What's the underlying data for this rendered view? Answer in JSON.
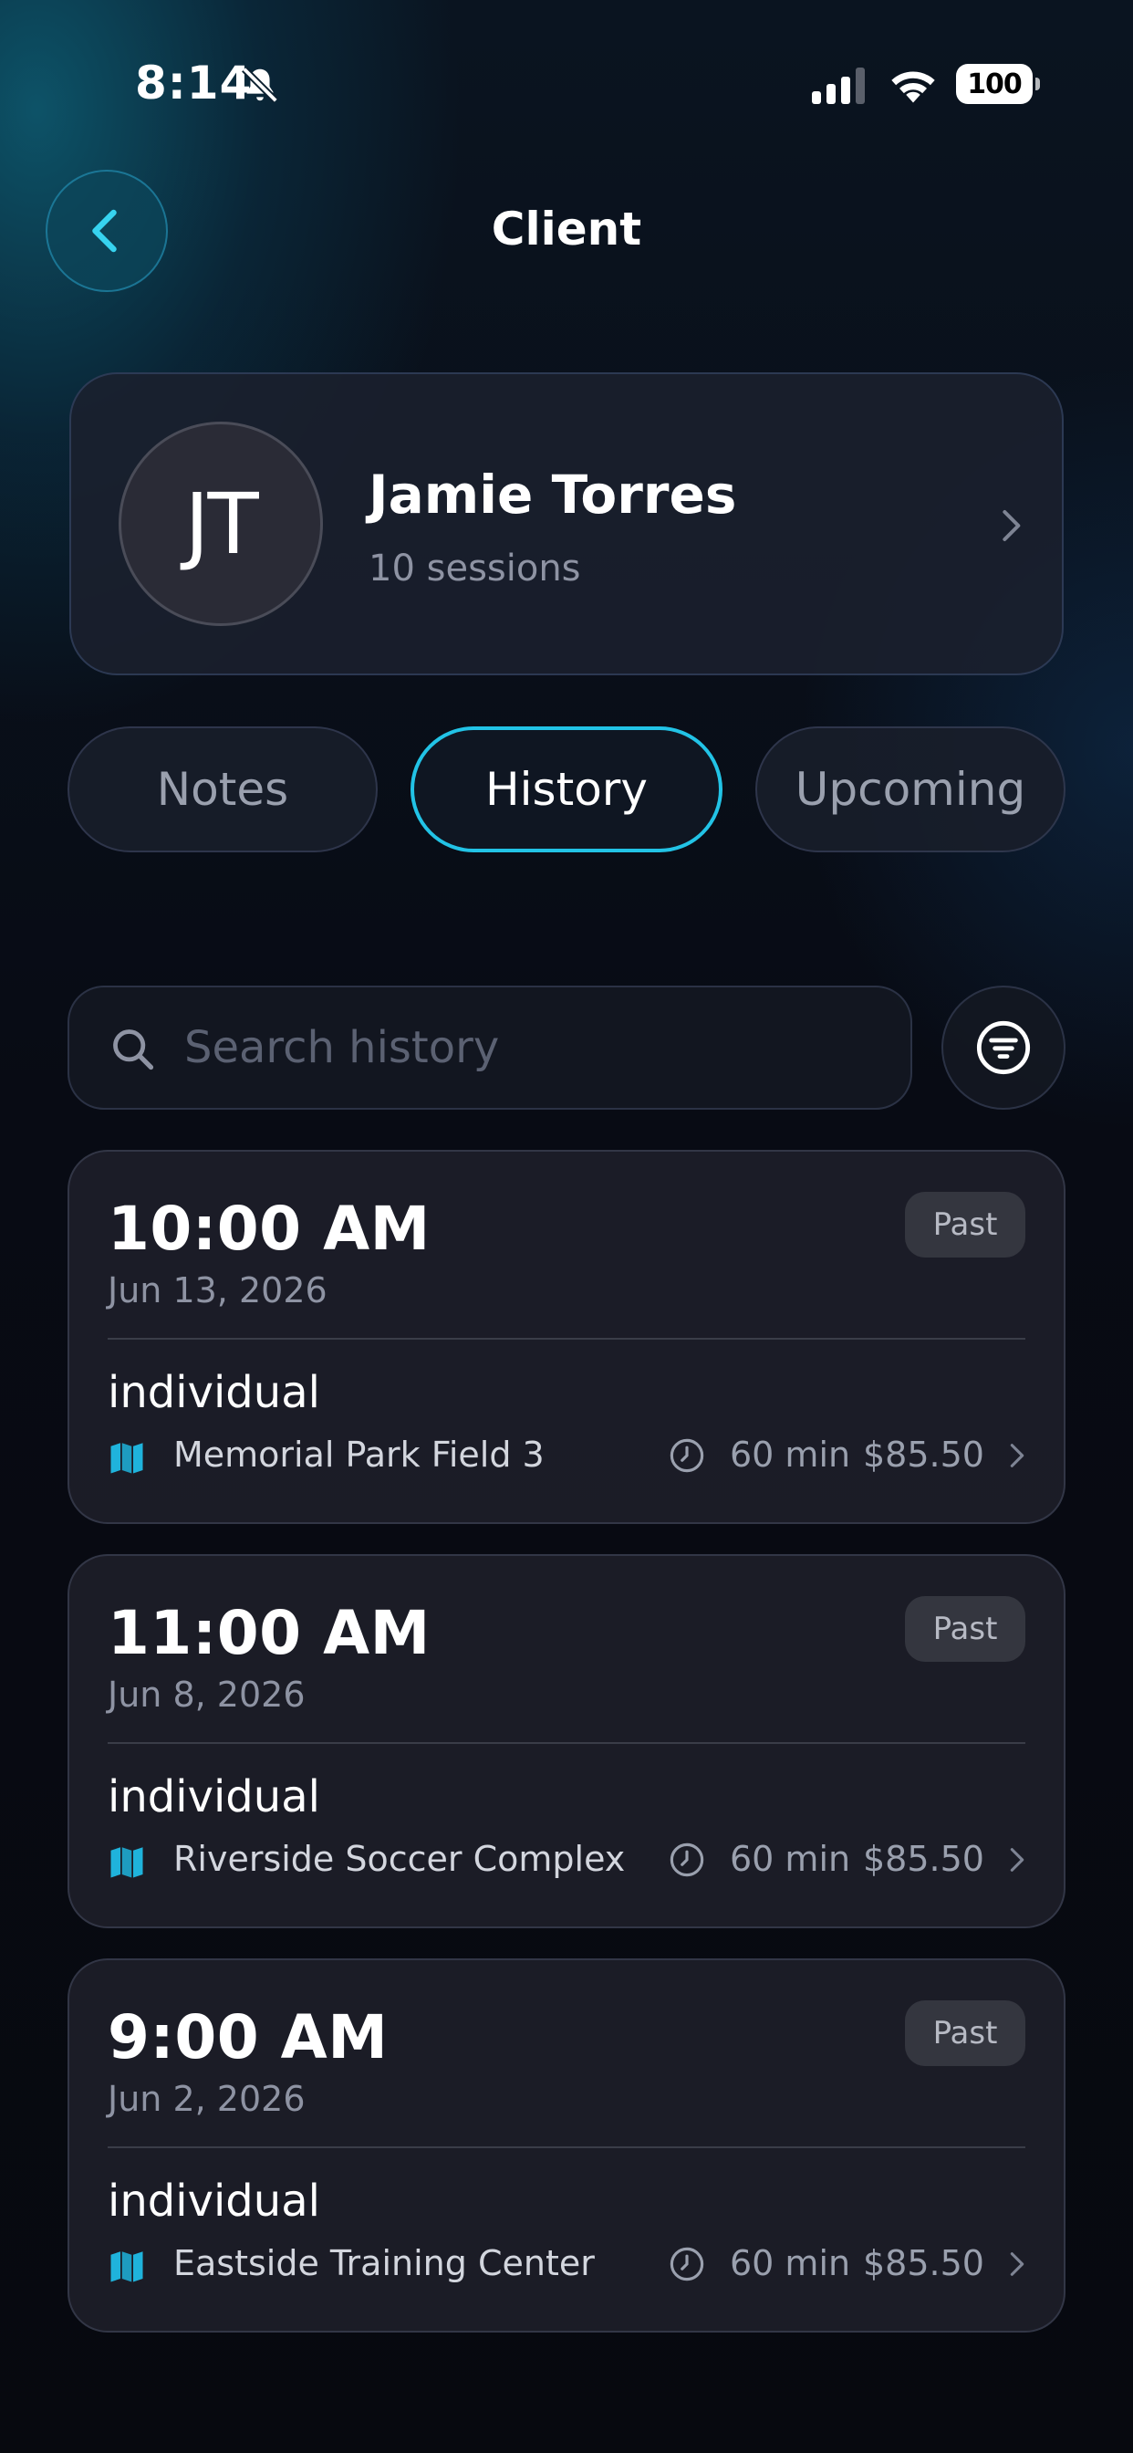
{
  "status_bar": {
    "time": "8:14",
    "battery": "100"
  },
  "header": {
    "title": "Client"
  },
  "client": {
    "initials": "JT",
    "name": "Jamie Torres",
    "sessions_label": "10 sessions"
  },
  "tabs": [
    {
      "label": "Notes",
      "active": false
    },
    {
      "label": "History",
      "active": true
    },
    {
      "label": "Upcoming",
      "active": false
    }
  ],
  "search": {
    "placeholder": "Search history",
    "value": ""
  },
  "sessions": [
    {
      "time": "10:00 AM",
      "date": "Jun 13, 2026",
      "badge": "Past",
      "type": "individual",
      "location": "Memorial Park Field 3",
      "duration": "60 min",
      "price": "$85.50"
    },
    {
      "time": "11:00 AM",
      "date": "Jun 8, 2026",
      "badge": "Past",
      "type": "individual",
      "location": "Riverside Soccer Complex",
      "duration": "60 min",
      "price": "$85.50"
    },
    {
      "time": "9:00 AM",
      "date": "Jun 2, 2026",
      "badge": "Past",
      "type": "individual",
      "location": "Eastside Training Center",
      "duration": "60 min",
      "price": "$85.50"
    }
  ],
  "colors": {
    "accent": "#22c3e6",
    "background": "#080b14",
    "card": "#1c1e28",
    "muted_text": "#8e93a3"
  },
  "icons": [
    "bell-slash-icon",
    "signal-icon",
    "wifi-icon",
    "battery-icon",
    "back-chevron-icon",
    "chevron-right-icon",
    "search-icon",
    "filter-icon",
    "map-icon",
    "clock-icon"
  ]
}
